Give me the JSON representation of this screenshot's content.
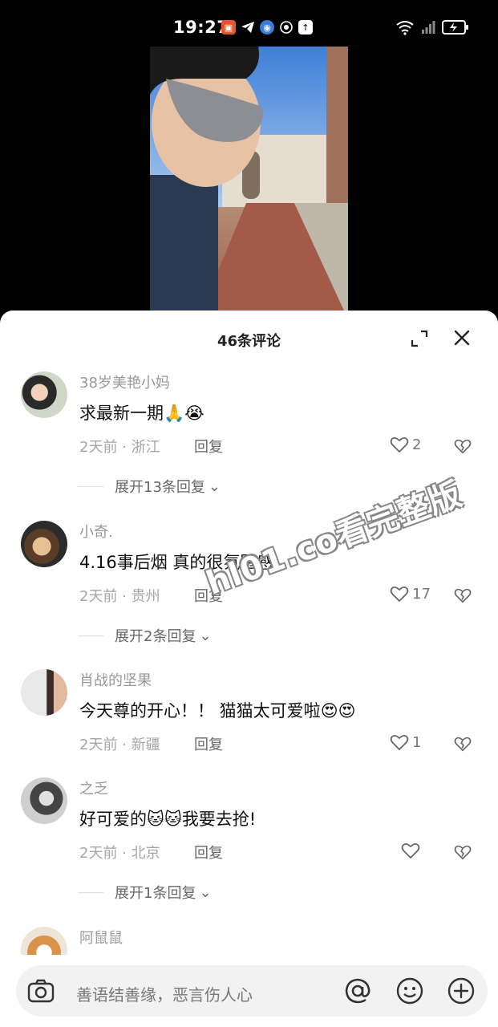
{
  "status_bar": {
    "time": "19:27",
    "icons": [
      "app-badge-icon",
      "telegram-icon",
      "browser-icon",
      "hotspot-icon",
      "upload-icon"
    ],
    "right_icons": [
      "wifi-icon",
      "signal-icon",
      "battery-charging-icon"
    ]
  },
  "comments_panel": {
    "title": "46条评论",
    "comments": [
      {
        "name": "38岁美艳小妈",
        "text": "求最新一期",
        "emojis": [
          "🙏",
          "😭"
        ],
        "time": "2天前",
        "location": "浙江",
        "reply_label": "回复",
        "likes": "2",
        "expand_label": "展开13条回复"
      },
      {
        "name": "小奇.",
        "text": "4.16事后烟 真的很氛围感",
        "emojis": [],
        "time": "2天前",
        "location": "贵州",
        "reply_label": "回复",
        "likes": "17",
        "expand_label": "展开2条回复"
      },
      {
        "name": "肖战的坚果",
        "text": "今天尊的开心！！ 猫猫太可爱啦",
        "emojis": [
          "😍",
          "😍"
        ],
        "time": "2天前",
        "location": "新疆",
        "reply_label": "回复",
        "likes": "1",
        "expand_label": ""
      },
      {
        "name": "之乏",
        "text_before": "好可爱的",
        "emojis": [
          "🐱",
          "🐱"
        ],
        "text_after": "我要去抢!",
        "time": "2天前",
        "location": "北京",
        "reply_label": "回复",
        "likes": "",
        "expand_label": "展开1条回复"
      },
      {
        "name": "阿鼠鼠"
      }
    ]
  },
  "input_bar": {
    "placeholder": "善语结善缘，恶言伤人心"
  },
  "watermark": "hl01.co看完整版",
  "colors": {
    "muted": "#999999",
    "text": "#111111",
    "sheet_bg": "#ffffff"
  }
}
